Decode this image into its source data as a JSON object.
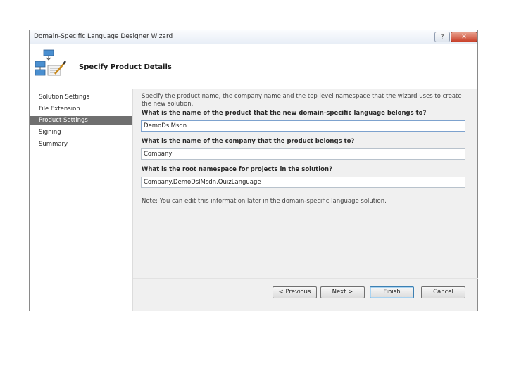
{
  "window": {
    "title": "Domain-Specific Language Designer Wizard",
    "help_label": "?",
    "close_label": "✕"
  },
  "header": {
    "title": "Specify Product Details",
    "icon": "wizard-diagram-icon"
  },
  "nav": {
    "items": [
      {
        "label": "Solution Settings"
      },
      {
        "label": "File Extension"
      },
      {
        "label": "Product Settings"
      },
      {
        "label": "Signing"
      },
      {
        "label": "Summary"
      }
    ],
    "selected_index": 2
  },
  "content": {
    "intro": "Specify the product name, the company name and the top level namespace that the wizard uses to create the new solution.",
    "product_question": "What is the name of the product that the new domain-specific language belongs to?",
    "product_value": "DemoDslMsdn",
    "company_question": "What is the name of the company that the product belongs to?",
    "company_value": "Company",
    "namespace_question": "What is the root namespace for projects in the solution?",
    "namespace_value": "Company.DemoDslMsdn.QuizLanguage",
    "note": "Note: You can edit this information later in the domain-specific language solution."
  },
  "buttons": {
    "previous": "< Previous",
    "next": "Next >",
    "finish": "Finish",
    "cancel": "Cancel"
  }
}
